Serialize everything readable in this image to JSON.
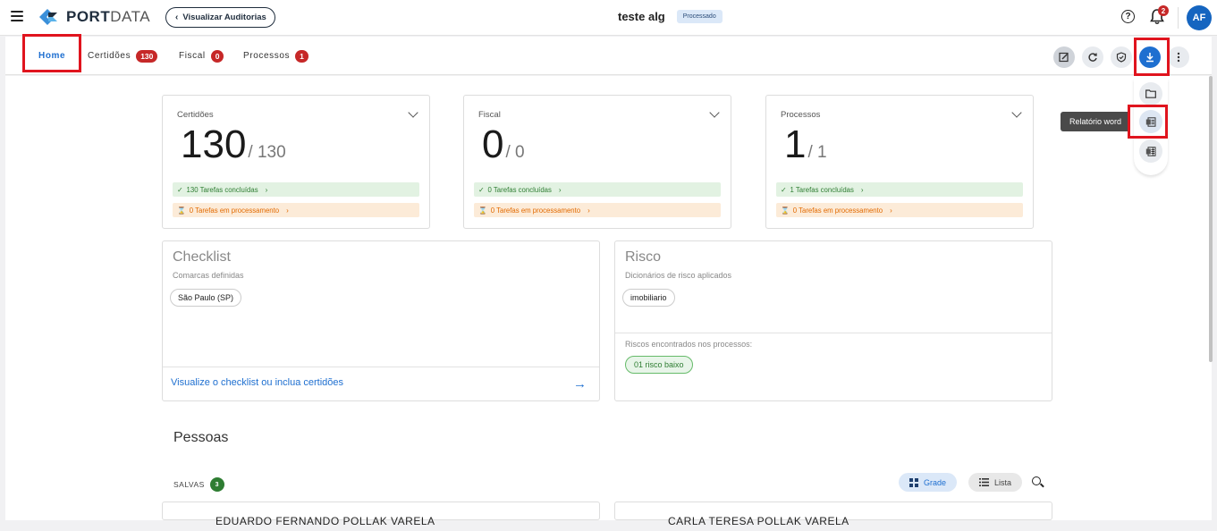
{
  "header": {
    "logo_main": "PORT",
    "logo_accent": "DATA",
    "back_label": "Visualizar Auditorias",
    "title": "teste alg",
    "status": "Processado",
    "help_symbol": "?",
    "notifications_count": "2",
    "avatar_initials": "AF"
  },
  "tabs": [
    {
      "label": "Home"
    },
    {
      "label": "Certidões",
      "count": "130"
    },
    {
      "label": "Fiscal",
      "count": "0"
    },
    {
      "label": "Processos",
      "count": "1"
    }
  ],
  "download_menu": {
    "tooltip": "Relatório word",
    "items": [
      "folder-icon",
      "word-report-icon",
      "excel-report-icon"
    ]
  },
  "stats": [
    {
      "label": "Certidões",
      "value": "130",
      "total": "/ 130",
      "done": "130 Tarefas concluídas",
      "processing": "0 Tarefas em processamento"
    },
    {
      "label": "Fiscal",
      "value": "0",
      "total": "/ 0",
      "done": "0 Tarefas concluídas",
      "processing": "0 Tarefas em processamento"
    },
    {
      "label": "Processos",
      "value": "1",
      "total": "/ 1",
      "done": "1 Tarefas concluídas",
      "processing": "0 Tarefas em processamento"
    }
  ],
  "checklist": {
    "title": "Checklist",
    "subtitle": "Comarcas definidas",
    "chip": "São Paulo (SP)",
    "link": "Visualize o checklist ou inclua certidões"
  },
  "risco": {
    "title": "Risco",
    "subtitle": "Dicionários de risco aplicados",
    "chip": "imobiliario",
    "found_label": "Riscos encontrados nos processos:",
    "found_chip": "01 risco baixo"
  },
  "pessoas": {
    "title": "Pessoas",
    "saved_label": "SALVAS",
    "saved_count": "3",
    "view_grid": "Grade",
    "view_list": "Lista",
    "people": [
      "EDUARDO FERNANDO POLLAK VARELA",
      "CARLA TERESA POLLAK VARELA"
    ]
  },
  "colors": {
    "accent": "#1e6fd0",
    "danger": "#c62828",
    "success": "#2e7d32",
    "warning": "#e26a00"
  }
}
